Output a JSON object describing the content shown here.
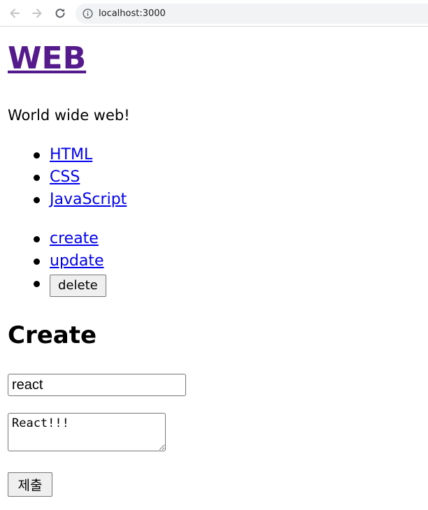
{
  "browser": {
    "url": "localhost:3000",
    "icons": [
      "back-arrow-icon",
      "forward-arrow-icon",
      "reload-icon",
      "info-icon"
    ]
  },
  "page": {
    "title": "WEB",
    "intro": "World wide web!",
    "topics": [
      {
        "label": "HTML"
      },
      {
        "label": "CSS"
      },
      {
        "label": "JavaScript"
      }
    ],
    "controls": {
      "create": "create",
      "update": "update",
      "delete": "delete"
    },
    "form": {
      "heading": "Create",
      "title_value": "react",
      "body_value": "React!!!",
      "submit_label": "제출"
    },
    "colors": {
      "visited_link": "#551a8b",
      "link": "#0000ee"
    }
  }
}
